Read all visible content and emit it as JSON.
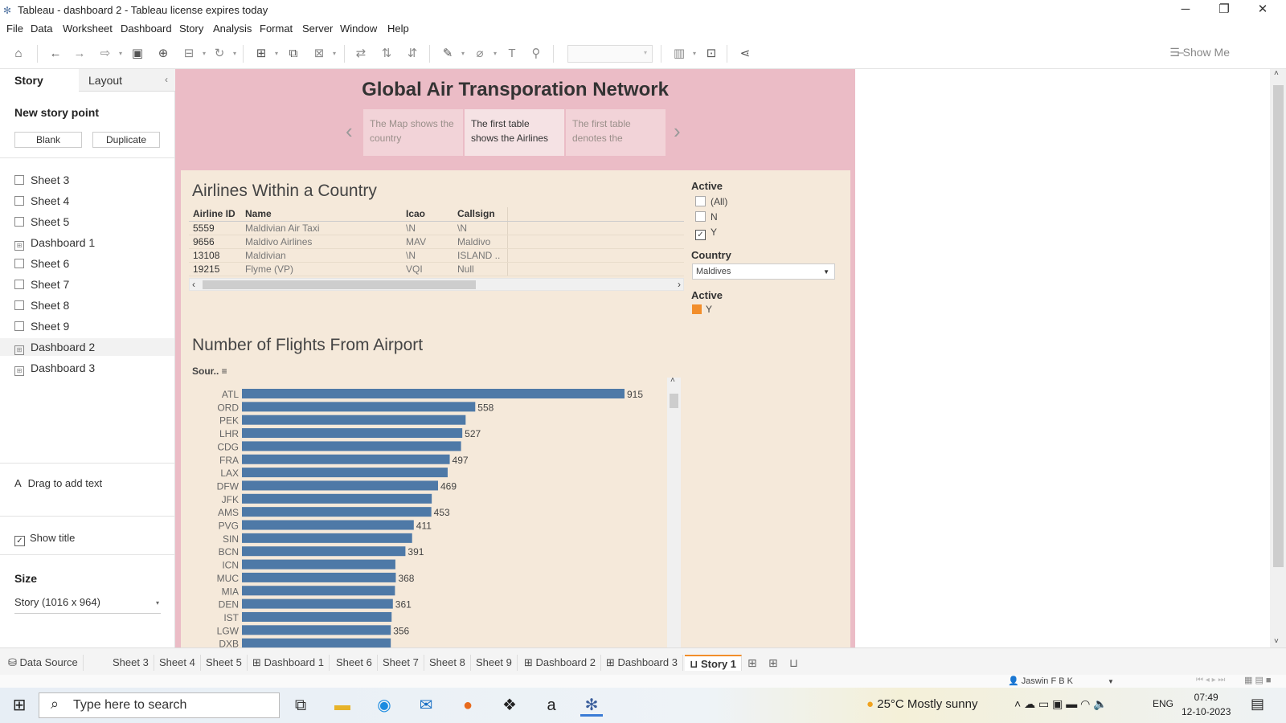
{
  "window": {
    "title": "Tableau - dashboard 2 - Tableau license expires today"
  },
  "menu": [
    "File",
    "Data",
    "Worksheet",
    "Dashboard",
    "Story",
    "Analysis",
    "Format",
    "Server",
    "Window",
    "Help"
  ],
  "toolbar": {
    "show_me": "Show Me"
  },
  "left_panel": {
    "tab_story": "Story",
    "tab_layout": "Layout",
    "new_story_point": "New story point",
    "blank_button": "Blank",
    "duplicate_button": "Duplicate",
    "sheets": [
      "Sheet 3",
      "Sheet 4",
      "Sheet 5",
      "Dashboard 1",
      "Sheet 6",
      "Sheet 7",
      "Sheet 8",
      "Sheet 9",
      "Dashboard 2",
      "Dashboard 3"
    ],
    "drag_text": "Drag to add text",
    "show_title": "Show title",
    "size_heading": "Size",
    "size_value": "Story (1016 x 964)"
  },
  "story": {
    "title": "Global Air Transporation Network",
    "points": [
      {
        "label": "The Map shows the country"
      },
      {
        "label": "The first table shows the Airlines"
      },
      {
        "label": "The first table denotes the"
      }
    ]
  },
  "airlines": {
    "title": "Airlines Within a Country",
    "columns": [
      "Airline ID",
      "Name",
      "Icao",
      "Callsign"
    ],
    "rows": [
      [
        "5559",
        "Maldivian Air Taxi",
        "\\N",
        "\\N"
      ],
      [
        "9656",
        "Maldivo Airlines",
        "MAV",
        "Maldivo"
      ],
      [
        "13108",
        "Maldivian",
        "\\N",
        "ISLAND .."
      ],
      [
        "19215",
        "Flyme (VP)",
        "VQI",
        "Null"
      ]
    ]
  },
  "filters": {
    "active_title": "Active",
    "active_options": [
      {
        "label": "(All)",
        "checked": false
      },
      {
        "label": "N",
        "checked": false
      },
      {
        "label": "Y",
        "checked": true
      }
    ],
    "country_title": "Country",
    "country_value": "Maldives",
    "legend_title": "Active",
    "legend_item": "Y",
    "legend_color": "#f28e2b"
  },
  "chart_data": {
    "type": "bar",
    "orientation": "horizontal",
    "title": "Number of Flights From Airport",
    "row_header": "Sour..",
    "categories": [
      "ATL",
      "ORD",
      "PEK",
      "LHR",
      "CDG",
      "FRA",
      "LAX",
      "DFW",
      "JFK",
      "AMS",
      "PVG",
      "SIN",
      "BCN",
      "ICN",
      "MUC",
      "MIA",
      "DEN",
      "IST",
      "LGW",
      "DXB"
    ],
    "values": [
      915,
      558,
      535,
      527,
      524,
      497,
      492,
      469,
      454,
      453,
      411,
      407,
      391,
      367,
      368,
      366,
      361,
      358,
      356,
      356
    ],
    "data_labels": [
      "915",
      "558",
      "",
      "527",
      "",
      "497",
      "",
      "469",
      "",
      "453",
      "411",
      "",
      "391",
      "",
      "368",
      "",
      "361",
      "",
      "356",
      ""
    ],
    "color": "#4e79a7"
  },
  "bottom_tabs": [
    "Data Source",
    "Sheet 3",
    "Sheet 4",
    "Sheet 5",
    "Dashboard 1",
    "Sheet 6",
    "Sheet 7",
    "Sheet 8",
    "Sheet 9",
    "Dashboard 2",
    "Dashboard 3",
    "Story 1"
  ],
  "status": {
    "user": "Jaswin F B K"
  },
  "taskbar": {
    "search_placeholder": "Type here to search",
    "weather": "25°C  Mostly sunny",
    "lang": "ENG",
    "time": "07:49",
    "date": "12-10-2023"
  }
}
